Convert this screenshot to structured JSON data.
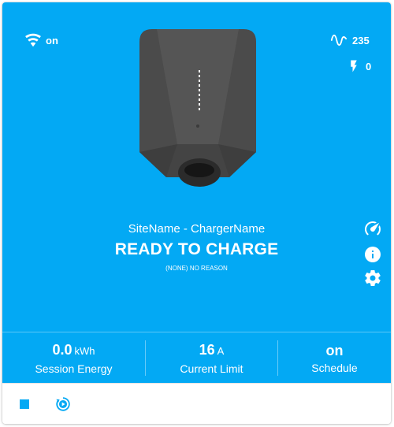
{
  "header": {
    "wifi": {
      "icon": "wifi-icon",
      "value": "on"
    },
    "voltage": {
      "icon": "sine-wave-icon",
      "value": "235"
    },
    "power": {
      "icon": "lightning-icon",
      "value": "0"
    }
  },
  "charger": {
    "site_name": "SiteName - ChargerName",
    "status": "READY TO CHARGE",
    "substatus": "(NONE) NO REASON"
  },
  "side_icons": [
    "speedometer-icon",
    "info-icon",
    "gear-icon"
  ],
  "stats": [
    {
      "value": "0.0",
      "unit": "kWh",
      "label": "Session Energy"
    },
    {
      "value": "16",
      "unit": "A",
      "label": "Current Limit"
    },
    {
      "value": "on",
      "unit": "",
      "label": "Schedule"
    }
  ],
  "footer": {
    "buttons": [
      "stop-icon",
      "play-circle-icon"
    ]
  },
  "colors": {
    "accent": "#03a9f4",
    "charger_body": "#4a4a4a",
    "footer_icon": "#03a9f4"
  }
}
